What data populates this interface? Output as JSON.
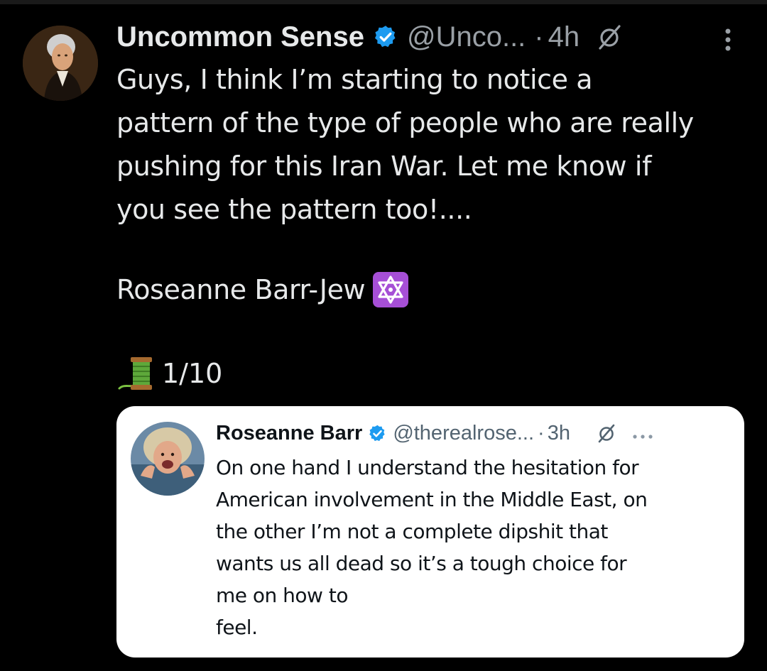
{
  "post": {
    "author_name": "Uncommon Sense",
    "handle": "@Unco...",
    "separator": "·",
    "time": "4h",
    "body": "Guys, I think I’m starting to notice a\npattern of the type of people who are really\npushing for this Iran War. Let me know if\nyou see the pattern too!....",
    "signature_text": "Roseanne Barr-Jew",
    "signature_emoji": "star-of-david-emoji",
    "thread_count": "1/10",
    "thread_emoji": "spool-of-thread-emoji",
    "verified_color": "#1d9bf0"
  },
  "quote": {
    "author_name": "Roseanne Barr",
    "handle": "@therealrose...",
    "separator": "·",
    "time": "3h",
    "body": "On one hand I understand the hesitation for\nAmerican involvement in the Middle East, on\nthe other I’m not a complete dipshit that\nwants us all dead so it’s a tough choice  for\nme on how to\nfeel."
  },
  "colors": {
    "background": "#000000",
    "text_primary": "#e7e9ea",
    "text_secondary": "#9aa0a6",
    "quote_background": "#ffffff",
    "quote_text": "#0f1419",
    "accent": "#1d9bf0"
  }
}
